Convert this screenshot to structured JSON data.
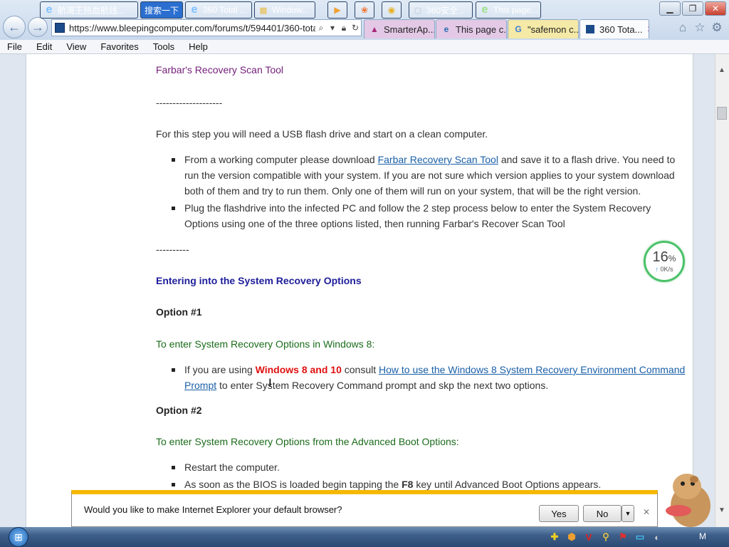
{
  "browser": {
    "url": "https://www.bleepingcomputer.com/forums/t/594401/360-total",
    "tabs": [
      {
        "label": "SmarterAp...",
        "color": "#e3c9e6",
        "icon_color": "#a8287a"
      },
      {
        "label": "This page c...",
        "color": "#e3c9e6",
        "icon_color": "#2b6cb0"
      },
      {
        "label": "\"safemon c...",
        "color": "#f4e9a6",
        "icon_color": "#3b7ddb"
      },
      {
        "label": "360 Tota...",
        "color": "#fafbfd",
        "icon_color": "#1c4b8a"
      }
    ],
    "tab_close": "✕",
    "menu": [
      "File",
      "Edit",
      "View",
      "Favorites",
      "Tools",
      "Help"
    ],
    "icons": [
      "home-icon",
      "star-icon",
      "gear-icon"
    ]
  },
  "content": {
    "heading_farbar": "Farbar's Recovery Scan Tool",
    "divider1": "--------------------",
    "intro": "For this step you will need a USB flash drive and start on a clean computer.",
    "bullet1": {
      "pre": "From a working computer please download ",
      "link": "Farbar Recovery Scan Tool",
      "post": " and save it to a flash drive. You need to",
      "line2": "run the version compatible with your system. If you are not sure which version applies to your system download",
      "line3": "both of them and try to run them. Only one of them will run on your system, that will be the right version."
    },
    "bullet2": {
      "line1": "Plug the flashdrive into the infected PC and follow the 2 step process below to enter the System Recovery",
      "line2": "Options using one of the three options listed, then running Farbar's Recover Scan Tool"
    },
    "divider2": "----------",
    "section_title": "Entering into the System Recovery Options",
    "option1": "Option #1",
    "option1_desc": "To enter System Recovery Options in Windows 8:",
    "bullet3": {
      "pre": "If you are using ",
      "red": "Windows 8 and 10",
      "mid": " consult ",
      "link1": "How to use the Windows 8 System Recovery Environment Command",
      "link2": "Prompt",
      "post": " to enter System Recovery Command prompt and skp the next two options."
    },
    "option2": "Option #2",
    "option2_desc": "To enter System Recovery Options from the Advanced Boot Options:",
    "bullet4": "Restart the computer.",
    "bullet5": {
      "pre": "As soon as the BIOS is loaded begin tapping the ",
      "key": "F8",
      "post": " key until Advanced Boot Options appears."
    }
  },
  "meter": {
    "percent": "16",
    "unit": "%",
    "speed": "0K/s",
    "arrow": "↑"
  },
  "notification": {
    "text": "Would you like to make Internet Explorer your default browser?",
    "yes": "Yes",
    "no": "No",
    "dropdown": "▼",
    "close": "✕"
  },
  "taskbar": {
    "items": [
      {
        "label": "航海王热血航线...",
        "icon": "e",
        "icon_color": "#2b7bd6"
      },
      {
        "label": "搜索一下",
        "icon": "",
        "icon_color": "#2a6fd0"
      },
      {
        "label": "360 Total ...",
        "icon": "e",
        "icon_color": "#2b7bd6"
      },
      {
        "label": "Window...",
        "icon": "▤",
        "icon_color": "#e8c15a"
      },
      {
        "label": "360安全...",
        "icon": "▢",
        "icon_color": "#c9d3df"
      },
      {
        "label": "This page...",
        "icon": "e",
        "icon_color": "#3aa14a"
      }
    ],
    "clock": "M"
  }
}
